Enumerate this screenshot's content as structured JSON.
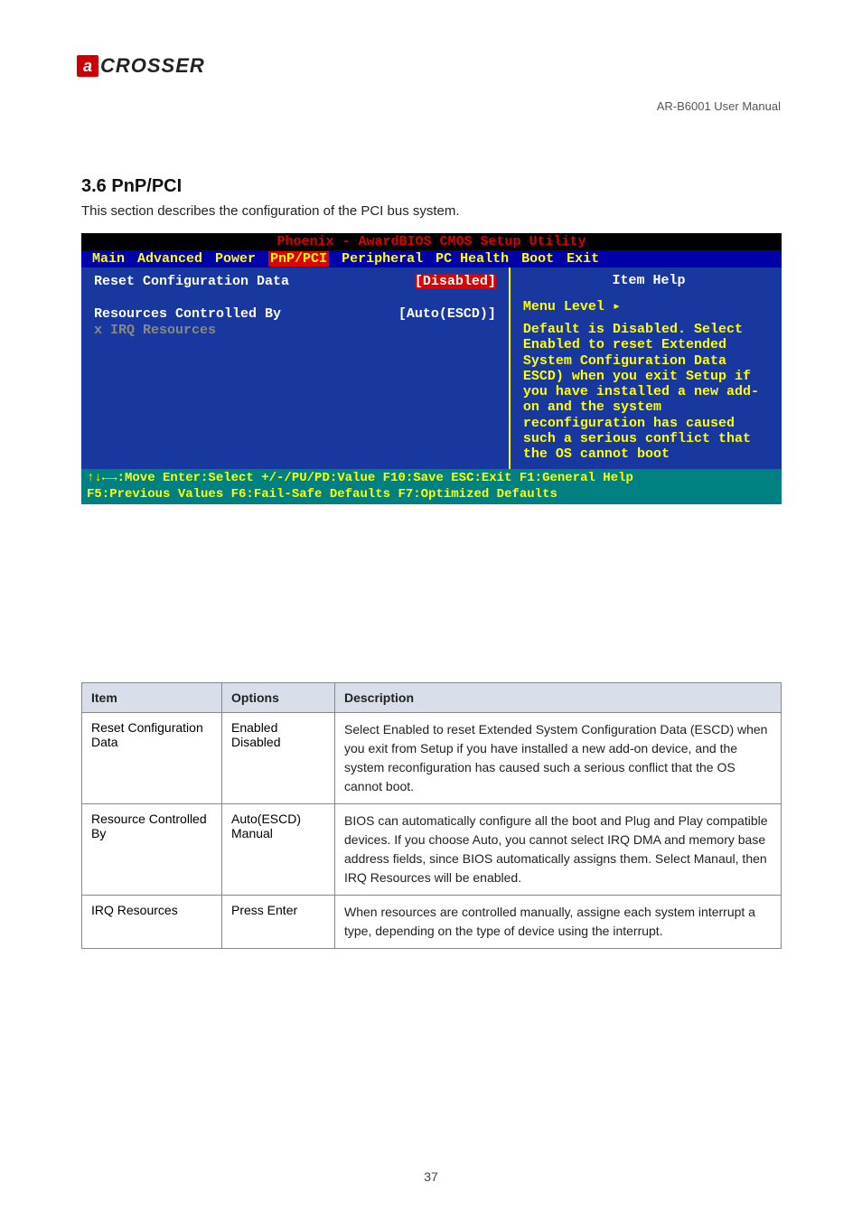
{
  "logo": {
    "letter": "a",
    "text": "CROSSER"
  },
  "page_header": "AR-B6001 User Manual",
  "section_title": "3.6 PnP/PCI",
  "subtitle": "This section describes the configuration of the PCI bus system.",
  "bios": {
    "title": "Phoenix - AwardBIOS CMOS Setup Utility",
    "menu": [
      "Main",
      "Advanced",
      "Power",
      "PnP/PCI",
      "Peripheral",
      "PC Health",
      "Boot",
      "Exit"
    ],
    "menu_sel": 3,
    "left_rows": [
      {
        "label": "Reset Configuration Data",
        "value": "[Disabled]",
        "sel": true,
        "grey": false
      },
      {
        "label": "",
        "value": "",
        "spacer": true
      },
      {
        "label": "Resources Controlled By",
        "value": "[Auto(ESCD)]",
        "sel": false,
        "grey": false
      },
      {
        "prefix": "x ",
        "label": "IRQ Resources",
        "value": "",
        "sel": false,
        "grey": true
      }
    ],
    "right": {
      "title": "Item Help",
      "level": "Menu Level   ▸",
      "help": "Default is Disabled. Select Enabled to reset Extended System Configuration Data ESCD) when you exit Setup if you have installed a new add-on and the system reconfiguration has caused such a serious conflict that the OS cannot boot"
    },
    "footer_line1": "↑↓←→:Move  Enter:Select  +/-/PU/PD:Value  F10:Save  ESC:Exit  F1:General Help",
    "footer_line2": "F5:Previous Values    F6:Fail-Safe Defaults    F7:Optimized Defaults"
  },
  "table": {
    "headers": [
      "Item",
      "Options",
      "Description"
    ],
    "rows": [
      {
        "item": "Reset Configuration Data",
        "options": "Enabled\nDisabled",
        "desc": "Select Enabled to reset Extended System Configuration Data (ESCD) when you exit from Setup if you have installed a new add-on device, and the system reconfiguration has caused such a serious conflict that the OS cannot boot."
      },
      {
        "item": "Resource Controlled By",
        "options": "Auto(ESCD)\nManual",
        "desc": "BIOS can automatically configure all the boot and Plug and Play compatible devices. If you choose Auto, you cannot select IRQ DMA and memory base address fields, since BIOS automatically assigns them. Select Manaul, then IRQ Resources will be enabled."
      },
      {
        "item": "IRQ Resources",
        "options": "Press Enter",
        "desc": "When resources are controlled manually, assigne each system interrupt a type, depending on the type of device using the interrupt."
      }
    ]
  },
  "page_num": "37"
}
